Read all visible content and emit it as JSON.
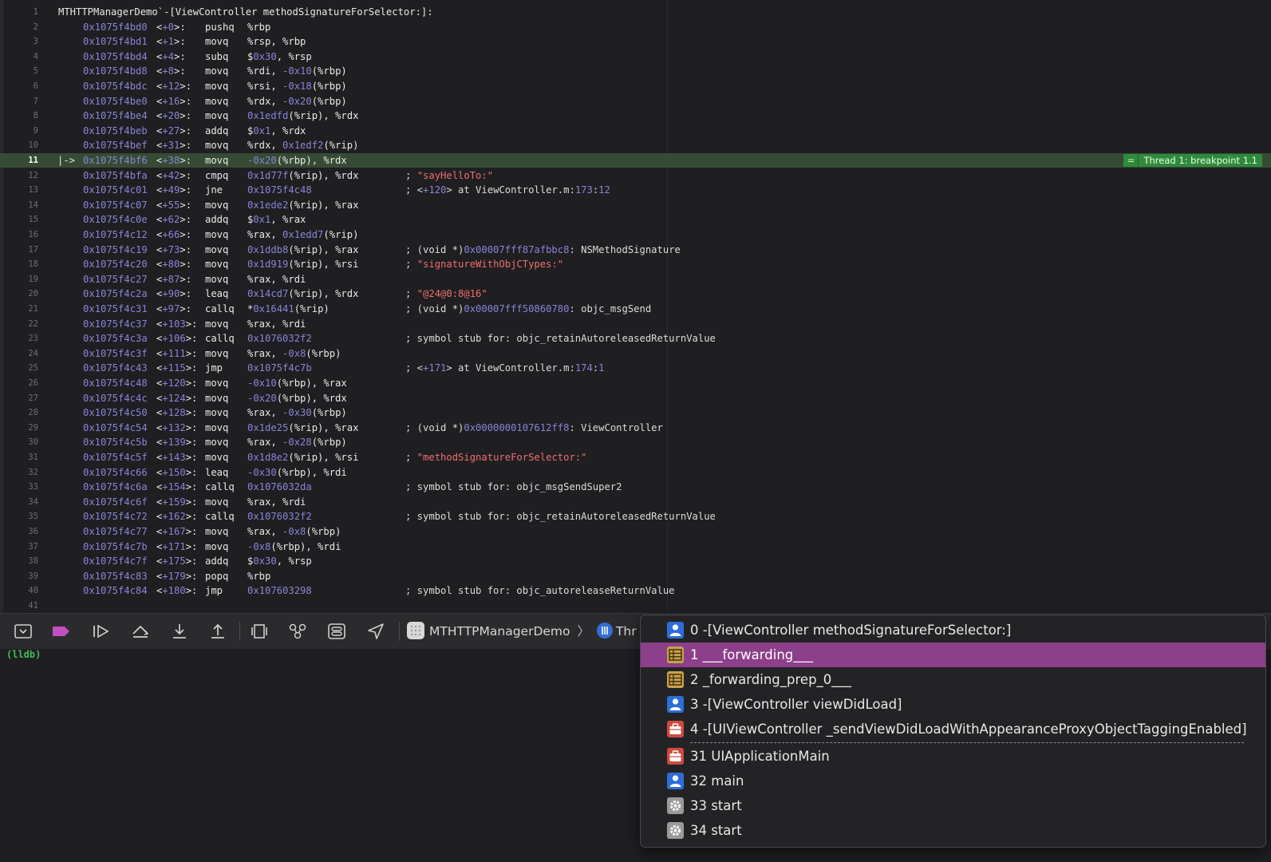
{
  "editor": {
    "header": "MTHTTPManagerDemo`-[ViewController methodSignatureForSelector:]:",
    "current_line_index": 10,
    "current_marker": "|->",
    "breakpoint_badge": "Thread 1: breakpoint 1.1",
    "breakpoint_badge_icon": "equals-icon",
    "lines": [
      {
        "n": "1",
        "hdr": "MTHTTPManagerDemo`-[ViewController methodSignatureForSelector:]:"
      },
      {
        "n": "2",
        "addr": "0x1075f4bd0",
        "off": "<+0>:",
        "op": "pushq",
        "args": "%rbp",
        "cmt": ""
      },
      {
        "n": "3",
        "addr": "0x1075f4bd1",
        "off": "<+1>:",
        "op": "movq",
        "args": "%rsp, %rbp",
        "cmt": ""
      },
      {
        "n": "4",
        "addr": "0x1075f4bd4",
        "off": "<+4>:",
        "op": "subq",
        "args": "$0x30, %rsp",
        "cmt": ""
      },
      {
        "n": "5",
        "addr": "0x1075f4bd8",
        "off": "<+8>:",
        "op": "movq",
        "args": "%rdi, -0x10(%rbp)",
        "cmt": ""
      },
      {
        "n": "6",
        "addr": "0x1075f4bdc",
        "off": "<+12>:",
        "op": "movq",
        "args": "%rsi, -0x18(%rbp)",
        "cmt": ""
      },
      {
        "n": "7",
        "addr": "0x1075f4be0",
        "off": "<+16>:",
        "op": "movq",
        "args": "%rdx, -0x20(%rbp)",
        "cmt": ""
      },
      {
        "n": "8",
        "addr": "0x1075f4be4",
        "off": "<+20>:",
        "op": "movq",
        "args": "0x1edfd(%rip), %rdx",
        "cmt": ""
      },
      {
        "n": "9",
        "addr": "0x1075f4beb",
        "off": "<+27>:",
        "op": "addq",
        "args": "$0x1, %rdx",
        "cmt": ""
      },
      {
        "n": "10",
        "addr": "0x1075f4bef",
        "off": "<+31>:",
        "op": "movq",
        "args": "%rdx, 0x1edf2(%rip)",
        "cmt": ""
      },
      {
        "n": "11",
        "addr": "0x1075f4bf6",
        "off": "<+38>:",
        "op": "movq",
        "args": "-0x20(%rbp), %rdx",
        "cmt": ""
      },
      {
        "n": "12",
        "addr": "0x1075f4bfa",
        "off": "<+42>:",
        "op": "cmpq",
        "args": "0x1d77f(%rip), %rdx",
        "cmt": "; \"sayHelloTo:\""
      },
      {
        "n": "13",
        "addr": "0x1075f4c01",
        "off": "<+49>:",
        "op": "jne",
        "args": "0x1075f4c48",
        "cmt": "; <+120> at ViewController.m:173:12"
      },
      {
        "n": "14",
        "addr": "0x1075f4c07",
        "off": "<+55>:",
        "op": "movq",
        "args": "0x1ede2(%rip), %rax",
        "cmt": ""
      },
      {
        "n": "15",
        "addr": "0x1075f4c0e",
        "off": "<+62>:",
        "op": "addq",
        "args": "$0x1, %rax",
        "cmt": ""
      },
      {
        "n": "16",
        "addr": "0x1075f4c12",
        "off": "<+66>:",
        "op": "movq",
        "args": "%rax, 0x1edd7(%rip)",
        "cmt": ""
      },
      {
        "n": "17",
        "addr": "0x1075f4c19",
        "off": "<+73>:",
        "op": "movq",
        "args": "0x1ddb8(%rip), %rax",
        "cmt": "; (void *)0x00007fff87afbbc8: NSMethodSignature"
      },
      {
        "n": "18",
        "addr": "0x1075f4c20",
        "off": "<+80>:",
        "op": "movq",
        "args": "0x1d919(%rip), %rsi",
        "cmt": "; \"signatureWithObjCTypes:\""
      },
      {
        "n": "19",
        "addr": "0x1075f4c27",
        "off": "<+87>:",
        "op": "movq",
        "args": "%rax, %rdi",
        "cmt": ""
      },
      {
        "n": "20",
        "addr": "0x1075f4c2a",
        "off": "<+90>:",
        "op": "leaq",
        "args": "0x14cd7(%rip), %rdx",
        "cmt": "; \"@24@0:8@16\""
      },
      {
        "n": "21",
        "addr": "0x1075f4c31",
        "off": "<+97>:",
        "op": "callq",
        "args": "*0x16441(%rip)",
        "cmt": "; (void *)0x00007fff50860780: objc_msgSend"
      },
      {
        "n": "22",
        "addr": "0x1075f4c37",
        "off": "<+103>:",
        "op": "movq",
        "args": "%rax, %rdi",
        "cmt": ""
      },
      {
        "n": "23",
        "addr": "0x1075f4c3a",
        "off": "<+106>:",
        "op": "callq",
        "args": "0x1076032f2",
        "cmt": "; symbol stub for: objc_retainAutoreleasedReturnValue"
      },
      {
        "n": "24",
        "addr": "0x1075f4c3f",
        "off": "<+111>:",
        "op": "movq",
        "args": "%rax, -0x8(%rbp)",
        "cmt": ""
      },
      {
        "n": "25",
        "addr": "0x1075f4c43",
        "off": "<+115>:",
        "op": "jmp",
        "args": "0x1075f4c7b",
        "cmt": "; <+171> at ViewController.m:174:1"
      },
      {
        "n": "26",
        "addr": "0x1075f4c48",
        "off": "<+120>:",
        "op": "movq",
        "args": "-0x10(%rbp), %rax",
        "cmt": ""
      },
      {
        "n": "27",
        "addr": "0x1075f4c4c",
        "off": "<+124>:",
        "op": "movq",
        "args": "-0x20(%rbp), %rdx",
        "cmt": ""
      },
      {
        "n": "28",
        "addr": "0x1075f4c50",
        "off": "<+128>:",
        "op": "movq",
        "args": "%rax, -0x30(%rbp)",
        "cmt": ""
      },
      {
        "n": "29",
        "addr": "0x1075f4c54",
        "off": "<+132>:",
        "op": "movq",
        "args": "0x1de25(%rip), %rax",
        "cmt": "; (void *)0x0000000107612ff8: ViewController"
      },
      {
        "n": "30",
        "addr": "0x1075f4c5b",
        "off": "<+139>:",
        "op": "movq",
        "args": "%rax, -0x28(%rbp)",
        "cmt": ""
      },
      {
        "n": "31",
        "addr": "0x1075f4c5f",
        "off": "<+143>:",
        "op": "movq",
        "args": "0x1d8e2(%rip), %rsi",
        "cmt": "; \"methodSignatureForSelector:\""
      },
      {
        "n": "32",
        "addr": "0x1075f4c66",
        "off": "<+150>:",
        "op": "leaq",
        "args": "-0x30(%rbp), %rdi",
        "cmt": ""
      },
      {
        "n": "33",
        "addr": "0x1075f4c6a",
        "off": "<+154>:",
        "op": "callq",
        "args": "0x1076032da",
        "cmt": "; symbol stub for: objc_msgSendSuper2"
      },
      {
        "n": "34",
        "addr": "0x1075f4c6f",
        "off": "<+159>:",
        "op": "movq",
        "args": "%rax, %rdi",
        "cmt": ""
      },
      {
        "n": "35",
        "addr": "0x1075f4c72",
        "off": "<+162>:",
        "op": "callq",
        "args": "0x1076032f2",
        "cmt": "; symbol stub for: objc_retainAutoreleasedReturnValue"
      },
      {
        "n": "36",
        "addr": "0x1075f4c77",
        "off": "<+167>:",
        "op": "movq",
        "args": "%rax, -0x8(%rbp)",
        "cmt": ""
      },
      {
        "n": "37",
        "addr": "0x1075f4c7b",
        "off": "<+171>:",
        "op": "movq",
        "args": "-0x8(%rbp), %rdi",
        "cmt": ""
      },
      {
        "n": "38",
        "addr": "0x1075f4c7f",
        "off": "<+175>:",
        "op": "addq",
        "args": "$0x30, %rsp",
        "cmt": ""
      },
      {
        "n": "39",
        "addr": "0x1075f4c83",
        "off": "<+179>:",
        "op": "popq",
        "args": "%rbp",
        "cmt": ""
      },
      {
        "n": "40",
        "addr": "0x1075f4c84",
        "off": "<+180>:",
        "op": "jmp",
        "args": "0x107603298",
        "cmt": "; symbol stub for: objc_autoreleaseReturnValue"
      },
      {
        "n": "41"
      }
    ]
  },
  "debugbar": {
    "tools": [
      {
        "name": "hide-debug-area-button",
        "icon": "hide-debug-area-icon"
      },
      {
        "name": "breakpoints-toggle-button",
        "icon": "breakpoint-icon"
      },
      {
        "name": "continue-button",
        "icon": "continue-icon"
      },
      {
        "name": "step-over-button",
        "icon": "step-over-icon"
      },
      {
        "name": "step-into-button",
        "icon": "step-into-icon"
      },
      {
        "name": "step-out-button",
        "icon": "step-out-icon"
      },
      {
        "name": "debug-view-hierarchy-button",
        "icon": "view-hierarchy-icon"
      },
      {
        "name": "memory-graph-button",
        "icon": "memory-graph-icon"
      },
      {
        "name": "environment-overrides-button",
        "icon": "environment-overrides-icon"
      },
      {
        "name": "simulate-location-button",
        "icon": "location-arrow-icon"
      }
    ],
    "breadcrumb": {
      "app": "MTHTTPManagerDemo",
      "thread": "Thr"
    }
  },
  "console": {
    "prompt": "(lldb)"
  },
  "stack_popup": {
    "selected_index": 1,
    "frames": [
      {
        "label": "0 -[ViewController methodSignatureForSelector:]",
        "kind": "user",
        "icon": "user-code-icon"
      },
      {
        "label": "1 ___forwarding___",
        "kind": "fwd",
        "icon": "corefoundation-frame-icon"
      },
      {
        "label": "2 _forwarding_prep_0___",
        "kind": "fwd",
        "icon": "corefoundation-frame-icon"
      },
      {
        "label": "3 -[ViewController viewDidLoad]",
        "kind": "user",
        "icon": "user-code-icon"
      },
      {
        "label": "4 -[UIViewController _sendViewDidLoadWithAppearanceProxyObjectTaggingEnabled]",
        "kind": "kit",
        "icon": "uikit-frame-icon"
      },
      {
        "label": "31 UIApplicationMain",
        "kind": "kit",
        "icon": "uikit-frame-icon"
      },
      {
        "label": "32 main",
        "kind": "user",
        "icon": "user-code-icon"
      },
      {
        "label": "33 start",
        "kind": "sys",
        "icon": "system-gear-icon"
      },
      {
        "label": "34 start",
        "kind": "sys",
        "icon": "system-gear-icon"
      }
    ]
  },
  "colors": {
    "background": "#1f1f22",
    "current_line": "#364b34",
    "breakpoint_badge": "#2f8a3b",
    "selected_frame": "#8c3f8a",
    "address": "#8a84d6",
    "string": "#ef6f6c",
    "lldb_prompt": "#3cbf55"
  }
}
